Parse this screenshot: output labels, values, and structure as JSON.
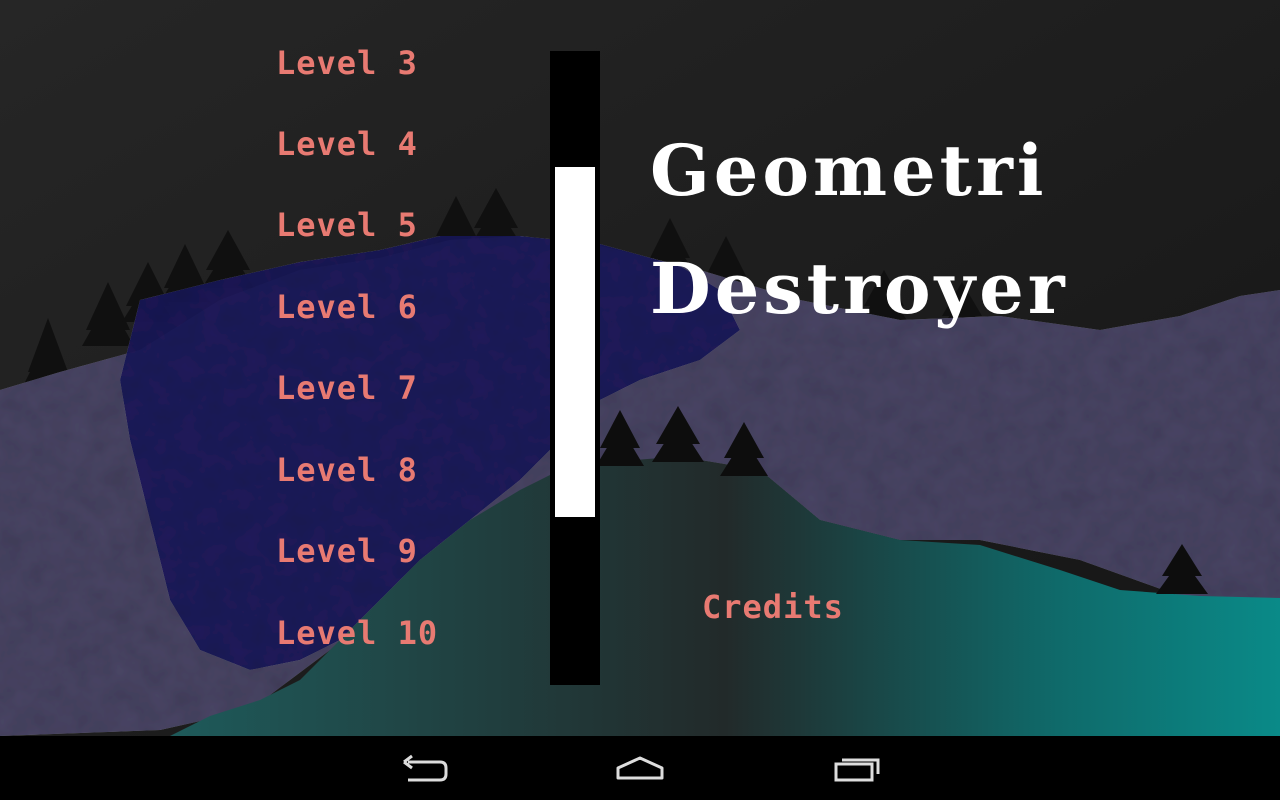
{
  "game": {
    "title_line1": "Geometri",
    "title_line2": "Destroyer"
  },
  "levels": [
    {
      "label": "Level 3"
    },
    {
      "label": "Level 4"
    },
    {
      "label": "Level 5"
    },
    {
      "label": "Level 6"
    },
    {
      "label": "Level 7"
    },
    {
      "label": "Level 8"
    },
    {
      "label": "Level 9"
    },
    {
      "label": "Level 10"
    }
  ],
  "menu": {
    "credits_label": "Credits"
  },
  "colors": {
    "level_text": "#e87a72",
    "title_text": "#ffffff",
    "scroll_track": "#000000",
    "scroll_thumb": "#ffffff",
    "navbar": "#000000"
  },
  "navbar": {
    "icons": [
      "back-icon",
      "home-icon",
      "recent-apps-icon"
    ]
  }
}
